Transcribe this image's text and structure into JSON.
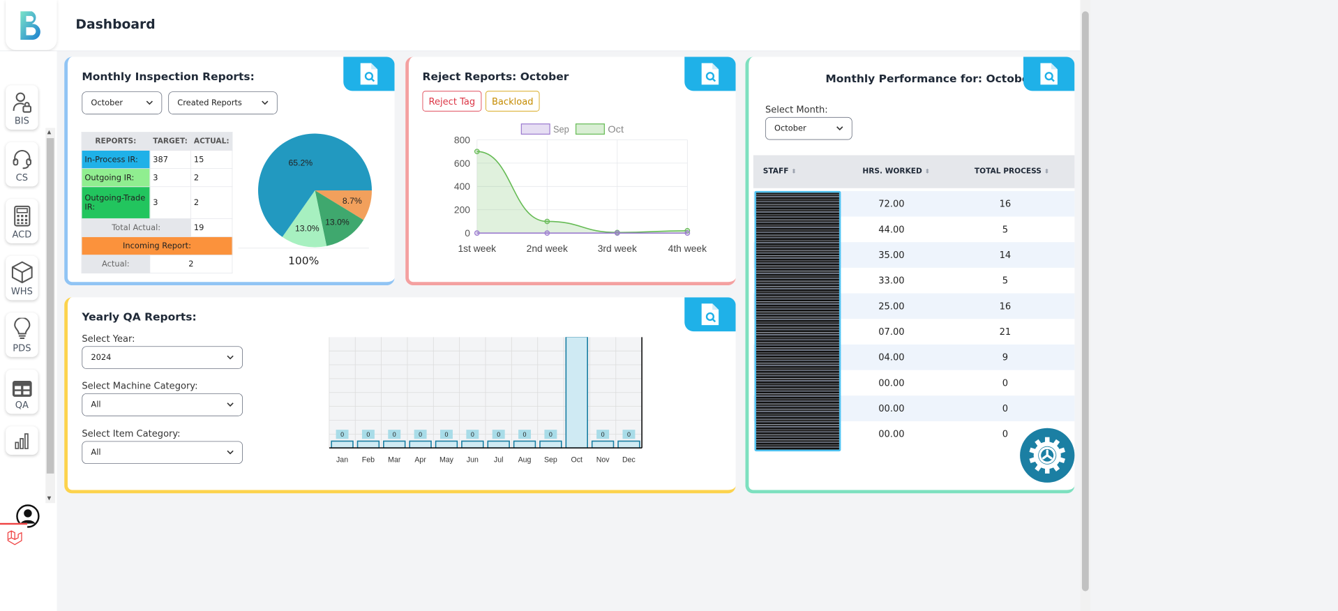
{
  "header": {
    "title": "Dashboard",
    "logo_letter": "B"
  },
  "sidebar": {
    "items": [
      {
        "label": "BIS",
        "icon": "user-lock-icon"
      },
      {
        "label": "CS",
        "icon": "headset-icon"
      },
      {
        "label": "ACD",
        "icon": "calculator-icon"
      },
      {
        "label": "WHS",
        "icon": "box-icon"
      },
      {
        "label": "PDS",
        "icon": "lightbulb-icon"
      },
      {
        "label": "QA",
        "icon": "table-icon"
      }
    ]
  },
  "inspection": {
    "title": "Monthly Inspection Reports:",
    "month_select": "October",
    "type_select": "Created Reports",
    "headers": [
      "REPORTS:",
      "TARGET:",
      "ACTUAL:"
    ],
    "rows": [
      {
        "label": "In-Process IR:",
        "target": "387",
        "actual": "15",
        "color": "#1fb1e8"
      },
      {
        "label": "Outgoing IR:",
        "target": "3",
        "actual": "2",
        "color": "#90ee90"
      },
      {
        "label": "Outgoing-Trade IR:",
        "target": "3",
        "actual": "2",
        "color": "#22c55e"
      }
    ],
    "total_label": "Total Actual:",
    "total_value": "19",
    "incoming_label": "Incoming Report:",
    "incoming_color": "#fb923c",
    "actual_label": "Actual:",
    "actual_value": "2",
    "pie_total": "100%"
  },
  "reject": {
    "title": "Reject Reports: October",
    "btn_reject": "Reject Tag",
    "btn_backload": "Backload",
    "legend": [
      "Sep",
      "Oct"
    ]
  },
  "performance": {
    "title": "Monthly Performance for: October",
    "select_label": "Select Month:",
    "month_select": "October",
    "headers": [
      "STAFF",
      "HRS. WORKED",
      "TOTAL PROCESS"
    ],
    "rows": [
      {
        "hrs": "72.00",
        "total": "16"
      },
      {
        "hrs": "44.00",
        "total": "5"
      },
      {
        "hrs": "35.00",
        "total": "14"
      },
      {
        "hrs": "33.00",
        "total": "5"
      },
      {
        "hrs": "25.00",
        "total": "16"
      },
      {
        "hrs": "07.00",
        "total": "21"
      },
      {
        "hrs": "04.00",
        "total": "9"
      },
      {
        "hrs": "00.00",
        "total": "0"
      },
      {
        "hrs": "00.00",
        "total": "0"
      },
      {
        "hrs": "00.00",
        "total": "0"
      }
    ]
  },
  "yearly": {
    "title": "Yearly QA Reports:",
    "year_label": "Select Year:",
    "year_value": "2024",
    "machine_label": "Select Machine Category:",
    "machine_value": "All",
    "item_label": "Select Item Category:",
    "item_value": "All"
  },
  "chart_data": [
    {
      "type": "pie",
      "labels": [
        "In-Process IR",
        "Outgoing IR",
        "Outgoing-Trade IR",
        "Incoming Report"
      ],
      "values": [
        65.2,
        13.0,
        13.0,
        8.7
      ],
      "value_labels": [
        "65.2%",
        "13.0%",
        "13.0%",
        "8.7%"
      ],
      "colors": [
        "#2299c0",
        "#a7f0c0",
        "#3fa86e",
        "#f2a05c"
      ]
    },
    {
      "type": "line",
      "categories": [
        "1st week",
        "2nd week",
        "3rd week",
        "4th week"
      ],
      "series": [
        {
          "name": "Sep",
          "values": [
            0,
            0,
            0,
            0
          ],
          "color": "#9b7bcf"
        },
        {
          "name": "Oct",
          "values": [
            700,
            100,
            5,
            20
          ],
          "color": "#66bb55"
        }
      ],
      "ylim": [
        0,
        800
      ],
      "yticks": [
        0,
        200,
        400,
        600,
        800
      ]
    },
    {
      "type": "bar",
      "categories": [
        "Jan",
        "Feb",
        "Mar",
        "Apr",
        "May",
        "Jun",
        "Jul",
        "Aug",
        "Sep",
        "Oct",
        "Nov",
        "Dec"
      ],
      "values": [
        0,
        0,
        0,
        0,
        0,
        0,
        0,
        0,
        0,
        15,
        0,
        0
      ],
      "ylim": [
        0,
        16
      ],
      "color": "#1b7fa3"
    }
  ]
}
